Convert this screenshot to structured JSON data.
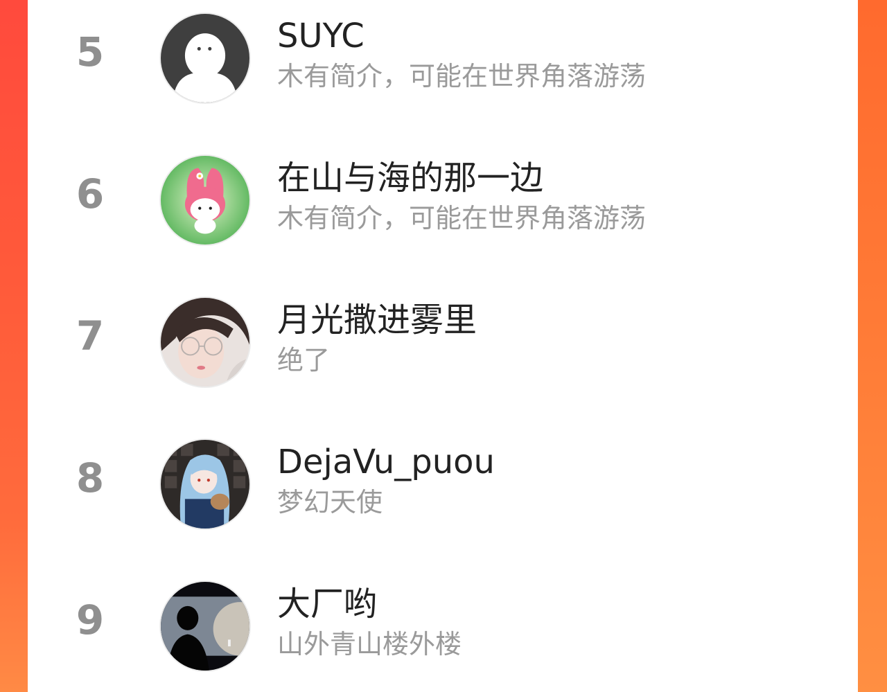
{
  "colors": {
    "accent_left": "#ff4a3d",
    "accent_right": "#ff7a36",
    "card_bg": "#ffffff",
    "rank_text": "#8f8f8f",
    "name_text": "#222222",
    "bio_text": "#9a9a9a"
  },
  "ranking": {
    "rows": [
      {
        "rank": "5",
        "name": "SUYC",
        "bio": "木有简介，可能在世界角落游荡",
        "avatar_icon": "default-ghost-avatar-icon"
      },
      {
        "rank": "6",
        "name": "在山与海的那一边",
        "bio": "木有简介，可能在世界角落游荡",
        "avatar_icon": "melody-sticker-avatar-icon"
      },
      {
        "rank": "7",
        "name": "月光撒进雾里",
        "bio": "绝了",
        "avatar_icon": "portrait-glasses-avatar-icon"
      },
      {
        "rank": "8",
        "name": "DejaVu_puou",
        "bio": "梦幻天使",
        "avatar_icon": "anime-girl-avatar-icon"
      },
      {
        "rank": "9",
        "name": "大厂哟",
        "bio": "山外青山楼外楼",
        "avatar_icon": "silhouette-moon-avatar-icon"
      }
    ]
  }
}
